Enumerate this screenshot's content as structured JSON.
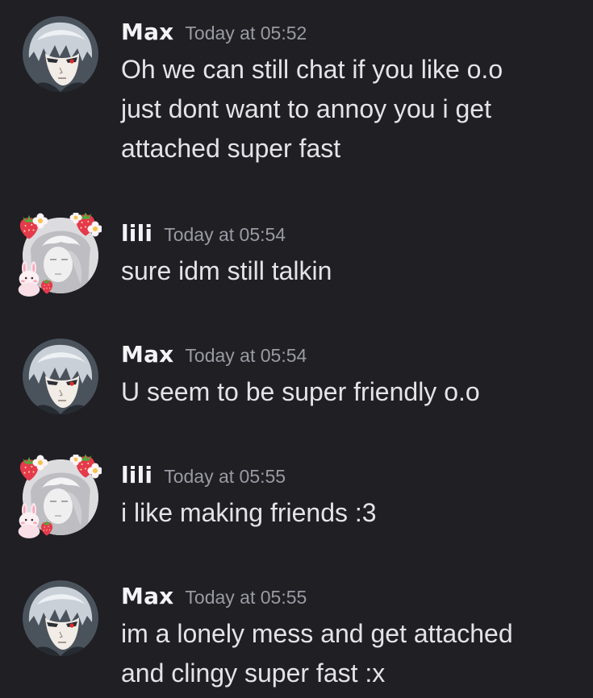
{
  "messages": [
    {
      "author": "Max",
      "timestamp": "Today at 05:52",
      "text": "Oh we can still chat if you like o.o\njust dont want to annoy you i get\nattached super fast",
      "avatar_icon": "anime-avatar-max"
    },
    {
      "author": "lili",
      "timestamp": "Today at 05:54",
      "text": "sure idm still talkin",
      "avatar_icon": "anime-avatar-lili-strawberry-frame"
    },
    {
      "author": "Max",
      "timestamp": "Today at 05:54",
      "text": "U seem to be super friendly o.o",
      "avatar_icon": "anime-avatar-max"
    },
    {
      "author": "lili",
      "timestamp": "Today at 05:55",
      "text": "i like making friends :3",
      "avatar_icon": "anime-avatar-lili-strawberry-frame"
    },
    {
      "author": "Max",
      "timestamp": "Today at 05:55",
      "text": "im a lonely mess and get attached\nand clingy super fast :x",
      "avatar_icon": "anime-avatar-max"
    }
  ],
  "colors": {
    "background": "#1f1f24",
    "username": "#f4f4f6",
    "timestamp": "#9a9aa3",
    "message_text": "#e3e3e8"
  }
}
